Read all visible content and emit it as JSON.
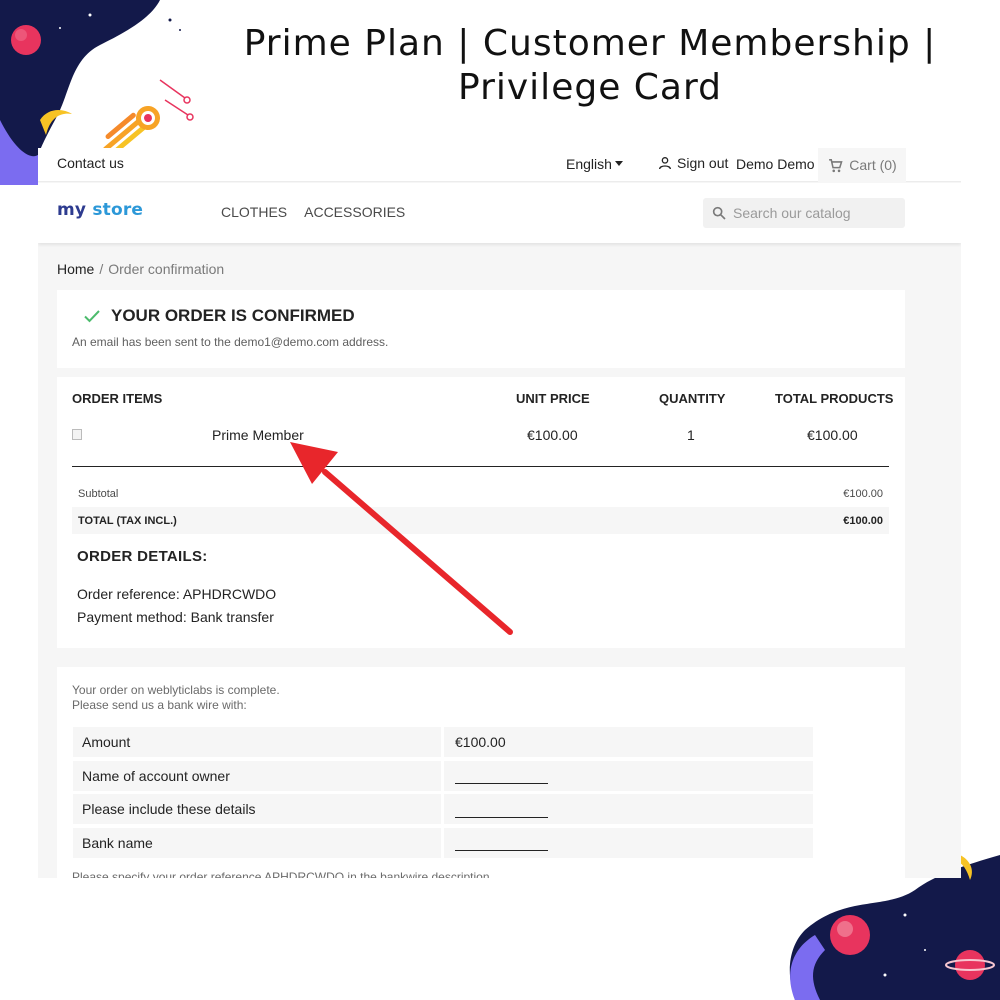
{
  "banner": {
    "title_line1": "Prime Plan | Customer Membership |",
    "title_line2": "Privilege Card"
  },
  "topnav": {
    "contact": "Contact us",
    "language": "English",
    "sign_out": "Sign out",
    "user_name": "Demo Demo",
    "cart": "Cart (0)"
  },
  "header": {
    "logo_part1": "my",
    "logo_part2": "store",
    "menu": [
      "CLOTHES",
      "ACCESSORIES"
    ],
    "search_placeholder": "Search our catalog"
  },
  "breadcrumb": {
    "home": "Home",
    "separator": "/",
    "current": "Order confirmation"
  },
  "confirmation": {
    "title": "YOUR ORDER IS CONFIRMED",
    "email_notice": "An email has been sent to the demo1@demo.com address."
  },
  "order_items": {
    "headers": {
      "items": "ORDER ITEMS",
      "unit_price": "UNIT PRICE",
      "quantity": "QUANTITY",
      "total": "TOTAL PRODUCTS"
    },
    "rows": [
      {
        "name": "Prime Member",
        "unit_price": "€100.00",
        "quantity": "1",
        "total": "€100.00"
      }
    ],
    "subtotal_label": "Subtotal",
    "subtotal_value": "€100.00",
    "total_label": "TOTAL (TAX INCL.)",
    "total_value": "€100.00"
  },
  "order_details": {
    "title": "ORDER DETAILS:",
    "reference": "Order reference: APHDRCWDO",
    "payment": "Payment method: Bank transfer"
  },
  "bank_wire": {
    "intro_line1": "Your order on weblyticlabs is complete.",
    "intro_line2": "Please send us a bank wire with:",
    "rows": [
      {
        "label": "Amount",
        "value": "€100.00"
      },
      {
        "label": "Name of account owner",
        "value": ""
      },
      {
        "label": "Please include these details",
        "value": ""
      },
      {
        "label": "Bank name",
        "value": ""
      }
    ],
    "note": "Please specify your order reference APHDRCWDO in the bankwire description."
  },
  "colors": {
    "check": "#4cbb6c",
    "arrow": "#e8262b",
    "logo_my": "#2d3b8f",
    "logo_store": "#2c98d8",
    "space_navy": "#13194a",
    "comet": "#f7a325"
  },
  "icons": [
    "check-icon",
    "user-icon",
    "cart-icon",
    "search-icon",
    "arrow-annotation"
  ]
}
